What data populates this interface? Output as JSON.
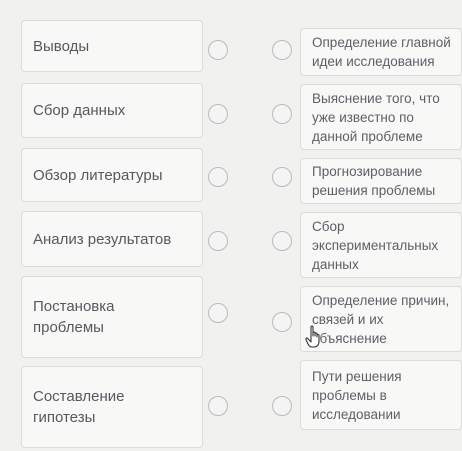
{
  "left_items": [
    {
      "label": "Выводы"
    },
    {
      "label": "Сбор данных"
    },
    {
      "label": "Обзор литературы"
    },
    {
      "label": "Анализ результатов"
    },
    {
      "label": "Постановка\nпроблемы"
    },
    {
      "label": "Составление\nгипотезы"
    }
  ],
  "right_items": [
    {
      "label": "Определение главной\nидеи исследования"
    },
    {
      "label": "Выяснение того, что\nуже известно по\nданной проблеме"
    },
    {
      "label": "Прогнозирование\nрешения проблемы"
    },
    {
      "label": "Сбор\nэкспериментальных\nданных"
    },
    {
      "label": "Определение причин,\nсвязей и их\nобъяснение"
    },
    {
      "label": "Пути решения\nпроблемы в\nисследовании"
    }
  ],
  "icons": {
    "radio": "radio-circle-icon",
    "cursor": "hand-pointer-icon"
  }
}
